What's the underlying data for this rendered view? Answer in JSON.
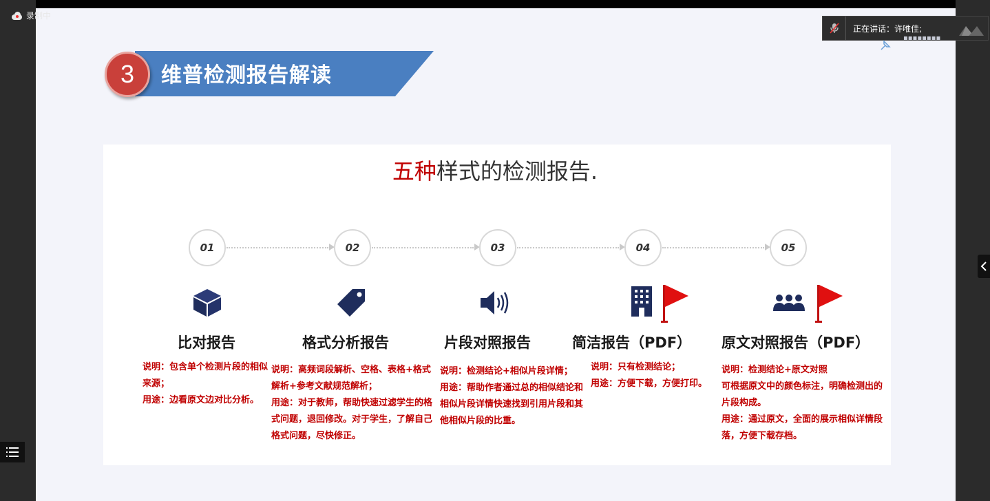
{
  "recording": {
    "label": "录制中"
  },
  "speaker": {
    "text": "正在讲话：许唯佳;"
  },
  "faint_text": "▪▪▪▪▪▪▪▪",
  "banner": {
    "number": "3",
    "title": "维普检测报告解读"
  },
  "heading": {
    "highlight": "五种",
    "rest": "样式的检测报告."
  },
  "steps": [
    {
      "num": "01",
      "title": "比对报告",
      "icon": "cube-icon",
      "desc": [
        "说明：包含单个检测片段的相似来源；",
        "用途：边看原文边对比分析。"
      ]
    },
    {
      "num": "02",
      "title": "格式分析报告",
      "icon": "tag-icon",
      "desc": [
        "说明：高频词段解析、空格、表格+格式解析+参考文献规范解析；",
        "用途：对于教师，帮助快速过滤学生的格式问题，退回修改。对于学生，了解自己格式问题，尽快修正。"
      ]
    },
    {
      "num": "03",
      "title": "片段对照报告",
      "icon": "speaker-icon",
      "desc": [
        "说明：检测结论+相似片段详情；",
        "用途：帮助作者通过总的相似结论和相似片段详情快速找到引用片段和其他相似片段的比重。"
      ]
    },
    {
      "num": "04",
      "title": "简洁报告（PDF）",
      "icon": "building-icon",
      "desc": [
        "说明：只有检测结论；",
        "用途：方便下载，方便打印。"
      ]
    },
    {
      "num": "05",
      "title": "原文对照报告（PDF）",
      "icon": "people-icon",
      "desc": [
        "说明：检测结论+原文对照",
        "可根据原文中的颜色标注，明确检测出的片段构成。",
        "用途：通过原文，全面的展示相似详情段落，方便下载存档。"
      ]
    }
  ],
  "colors": {
    "accent_red": "#c00000",
    "banner_blue": "#4a7fc1",
    "icon_navy": "#1f2d5c",
    "flag_red": "#e01010"
  }
}
